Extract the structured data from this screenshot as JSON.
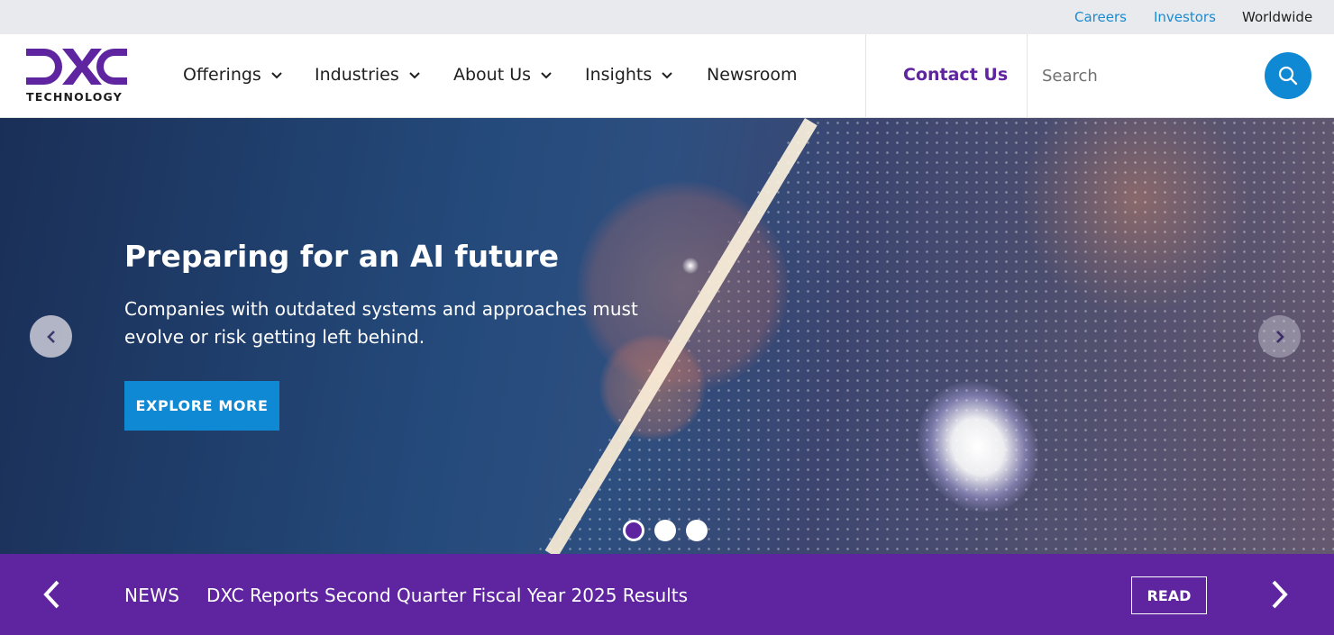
{
  "utility_nav": {
    "careers": "Careers",
    "investors": "Investors",
    "worldwide": "Worldwide"
  },
  "logo": {
    "brand": "DXC",
    "sub": "TECHNOLOGY"
  },
  "main_nav": {
    "items": [
      {
        "label": "Offerings",
        "has_dropdown": true
      },
      {
        "label": "Industries",
        "has_dropdown": true
      },
      {
        "label": "About Us",
        "has_dropdown": true
      },
      {
        "label": "Insights",
        "has_dropdown": true
      },
      {
        "label": "Newsroom",
        "has_dropdown": false
      }
    ],
    "contact": "Contact Us"
  },
  "search": {
    "placeholder": "Search",
    "value": ""
  },
  "hero": {
    "title": "Preparing for an AI future",
    "text": "Companies with outdated systems and approaches must evolve or risk getting left behind.",
    "cta": "EXPLORE MORE",
    "slides_total": 3,
    "active_slide": 1
  },
  "news": {
    "label": "NEWS",
    "headline": "DXC Reports Second Quarter Fiscal Year 2025 Results",
    "read": "READ"
  },
  "colors": {
    "brand_purple": "#5f249f",
    "accent_blue": "#1089d4",
    "utility_bg": "#e9eaee"
  },
  "icons": [
    "chevron-down-icon",
    "search-icon",
    "chevron-left-icon",
    "chevron-right-icon"
  ]
}
